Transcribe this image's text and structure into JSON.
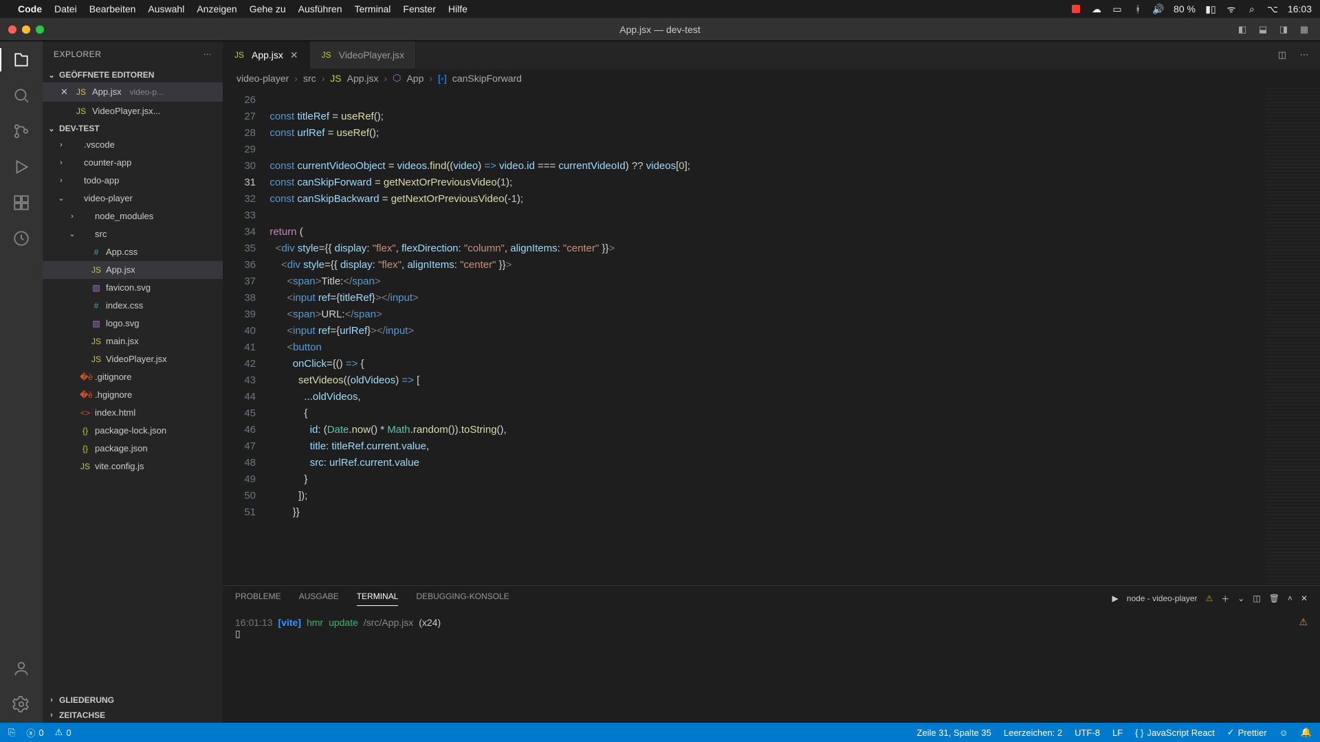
{
  "mac": {
    "app": "Code",
    "menus": [
      "Datei",
      "Bearbeiten",
      "Auswahl",
      "Anzeigen",
      "Gehe zu",
      "Ausführen",
      "Terminal",
      "Fenster",
      "Hilfe"
    ],
    "battery": "80 %",
    "time": "16:03"
  },
  "window": {
    "title": "App.jsx — dev-test"
  },
  "sidebar": {
    "title": "EXPLORER",
    "openEditorsLabel": "GEÖFFNETE EDITOREN",
    "projectLabel": "DEV-TEST",
    "outlineLabel": "GLIEDERUNG",
    "timelineLabel": "ZEITACHSE",
    "openEditors": [
      {
        "name": "App.jsx",
        "hint": "video-p...",
        "dirty": false,
        "active": true
      },
      {
        "name": "VideoPlayer.jsx...",
        "hint": "",
        "dirty": false,
        "active": false
      }
    ],
    "tree": [
      {
        "name": ".vscode",
        "kind": "folder",
        "depth": 1
      },
      {
        "name": "counter-app",
        "kind": "folder",
        "depth": 1
      },
      {
        "name": "todo-app",
        "kind": "folder",
        "depth": 1
      },
      {
        "name": "video-player",
        "kind": "folder",
        "depth": 1,
        "open": true
      },
      {
        "name": "node_modules",
        "kind": "folder",
        "depth": 2
      },
      {
        "name": "src",
        "kind": "folder",
        "depth": 2,
        "open": true
      },
      {
        "name": "App.css",
        "kind": "css",
        "depth": 3
      },
      {
        "name": "App.jsx",
        "kind": "js",
        "depth": 3,
        "selected": true
      },
      {
        "name": "favicon.svg",
        "kind": "svg",
        "depth": 3
      },
      {
        "name": "index.css",
        "kind": "css",
        "depth": 3
      },
      {
        "name": "logo.svg",
        "kind": "svg",
        "depth": 3
      },
      {
        "name": "main.jsx",
        "kind": "js",
        "depth": 3
      },
      {
        "name": "VideoPlayer.jsx",
        "kind": "js",
        "depth": 3
      },
      {
        "name": ".gitignore",
        "kind": "git",
        "depth": 2
      },
      {
        "name": ".hgignore",
        "kind": "git",
        "depth": 2
      },
      {
        "name": "index.html",
        "kind": "html",
        "depth": 2
      },
      {
        "name": "package-lock.json",
        "kind": "json",
        "depth": 2
      },
      {
        "name": "package.json",
        "kind": "json",
        "depth": 2
      },
      {
        "name": "vite.config.js",
        "kind": "js",
        "depth": 2
      }
    ]
  },
  "tabs": [
    {
      "label": "App.jsx",
      "active": true
    },
    {
      "label": "VideoPlayer.jsx",
      "active": false
    }
  ],
  "breadcrumbs": [
    "video-player",
    "src",
    "App.jsx",
    "App",
    "canSkipForward"
  ],
  "editor": {
    "firstLine": 26,
    "currentLine": 31
  },
  "panel": {
    "tabs": [
      "PROBLEME",
      "AUSGABE",
      "TERMINAL",
      "DEBUGGING-KONSOLE"
    ],
    "activeTab": "TERMINAL",
    "processLabel": "node - video-player",
    "terminal": {
      "time": "16:01:13",
      "tag": "[vite]",
      "msg1": "hmr",
      "msg2": "update",
      "path": "/src/App.jsx",
      "count": "(x24)"
    }
  },
  "status": {
    "errors": "0",
    "warnings": "0",
    "pos": "Zeile 31, Spalte 35",
    "spaces": "Leerzeichen: 2",
    "encoding": "UTF-8",
    "eol": "LF",
    "lang": "JavaScript React",
    "prettier": "Prettier"
  }
}
